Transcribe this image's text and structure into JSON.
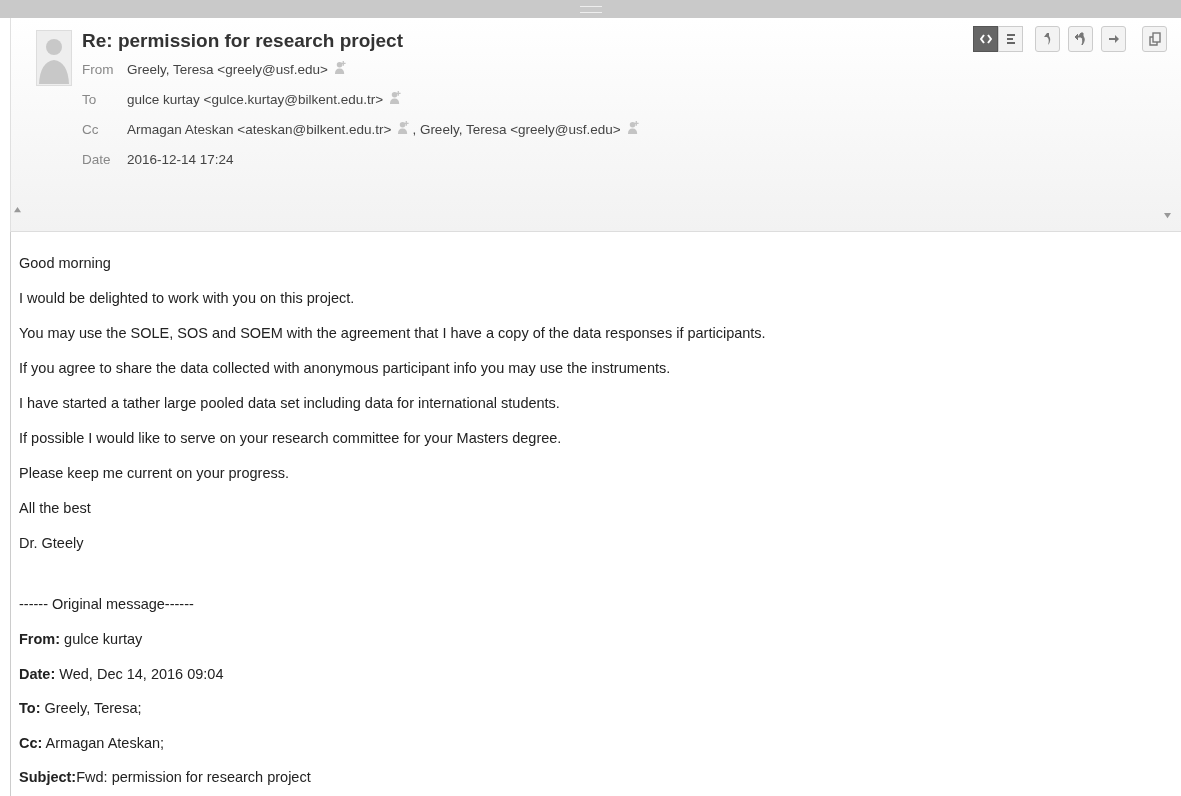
{
  "message": {
    "subject": "Re: permission for research project",
    "fields": [
      {
        "label": "From",
        "recipients": [
          {
            "text": "Greely, Teresa <greely@usf.edu>"
          }
        ]
      },
      {
        "label": "To",
        "recipients": [
          {
            "text": "gulce kurtay <gulce.kurtay@bilkent.edu.tr>"
          }
        ]
      },
      {
        "label": "Cc",
        "recipients": [
          {
            "text": "Armagan Ateskan <ateskan@bilkent.edu.tr>"
          },
          {
            "text": ", Greely, Teresa <greely@usf.edu>"
          }
        ]
      },
      {
        "label": "Date",
        "value": "2016-12-14 17:24"
      }
    ],
    "view_toggle": [
      {
        "kind": "html",
        "selected": true
      },
      {
        "kind": "plain",
        "selected": false
      }
    ],
    "actions": [
      {
        "kind": "reply"
      },
      {
        "kind": "reply-all"
      },
      {
        "kind": "forward"
      },
      {
        "kind": "popout"
      }
    ]
  },
  "body": {
    "lines": [
      "Good morning",
      "I would be delighted to work with you on this project.",
      "You may use the SOLE, SOS and SOEM with the agreement that I have a copy of the data responses if participants.",
      "If you agree to share the data collected with anonymous participant info you may use the instruments.",
      "I have started a tather large pooled data set including data for international students.",
      "If possible I would like to serve on your research committee for your Masters degree.",
      "Please keep me current on your progress.",
      "All the best",
      "Dr. Gteely"
    ],
    "quote_separator": "------ Original message------",
    "quote_lines": [
      "**From:** gulce kurtay",
      "**Date:** Wed, Dec 14, 2016 09:04",
      "**To:** Greely, Teresa;",
      "**Cc:** Armagan Ateskan;",
      "**Subject:**Fwd: permission for research project"
    ]
  }
}
